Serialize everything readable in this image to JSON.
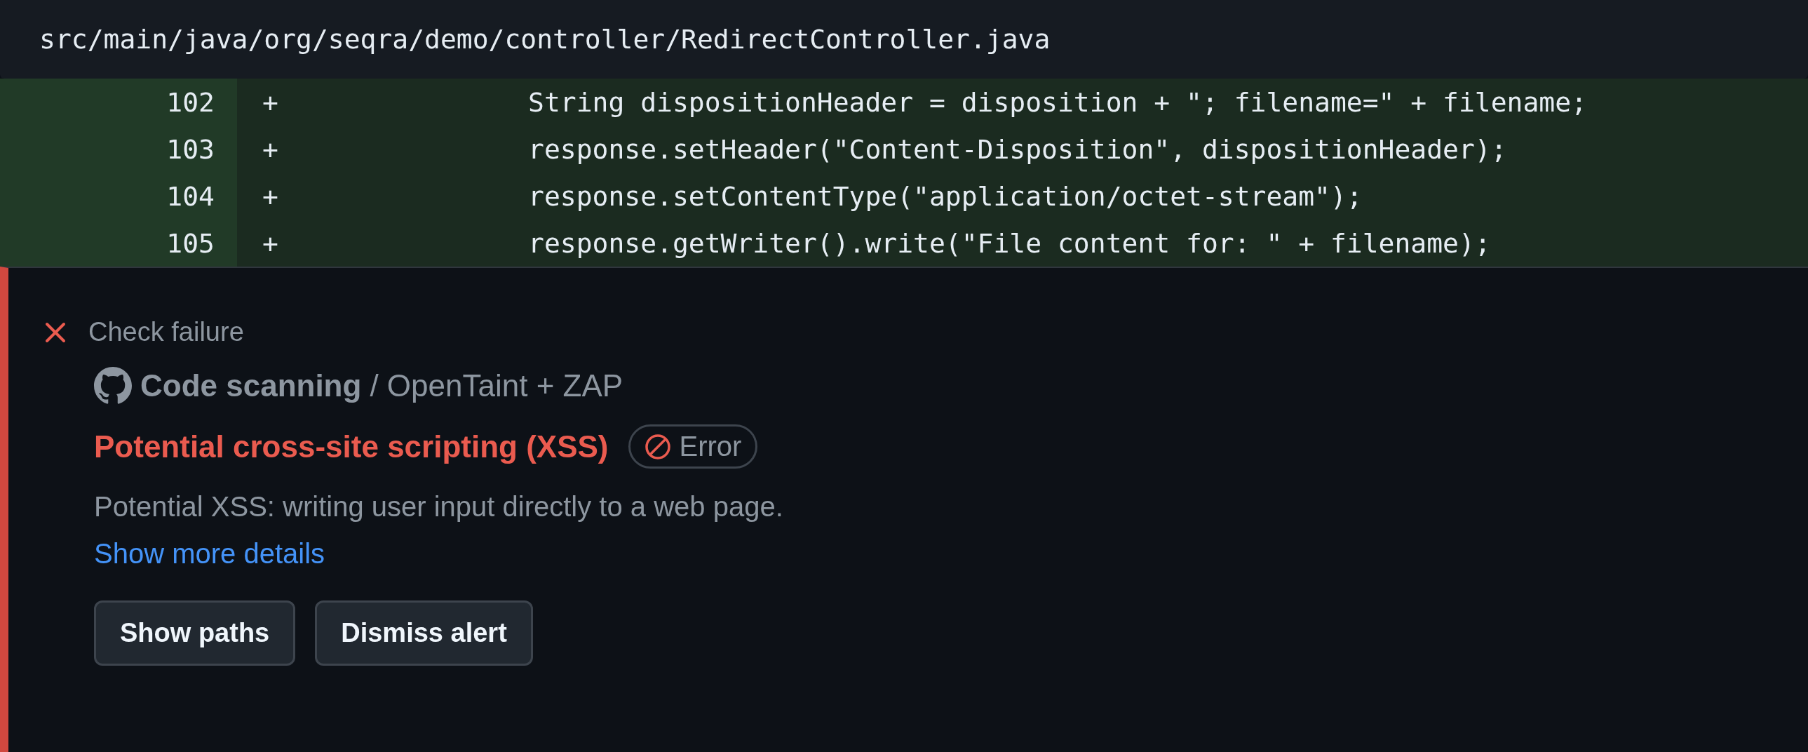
{
  "file_path": "src/main/java/org/seqra/demo/controller/RedirectController.java",
  "diff_lines": [
    {
      "number": "102",
      "sign": "+",
      "kind": "added",
      "code": "String dispositionHeader = disposition + \"; filename=\" + filename;"
    },
    {
      "number": "103",
      "sign": "+",
      "kind": "added",
      "code": "response.setHeader(\"Content-Disposition\", dispositionHeader);"
    },
    {
      "number": "104",
      "sign": "+",
      "kind": "added",
      "code": "response.setContentType(\"application/octet-stream\");"
    },
    {
      "number": "105",
      "sign": "+",
      "kind": "added",
      "code": "response.getWriter().write(\"File content for: \" + filename);"
    }
  ],
  "alert": {
    "status": "Check failure",
    "tool": "Code scanning",
    "source": "/ OpenTaint + ZAP",
    "title": "Potential cross-site scripting (XSS)",
    "severity": "Error",
    "description": "Potential XSS: writing user input directly to a web page.",
    "link": "Show more details",
    "buttons": [
      "Show paths",
      "Dismiss alert"
    ]
  }
}
